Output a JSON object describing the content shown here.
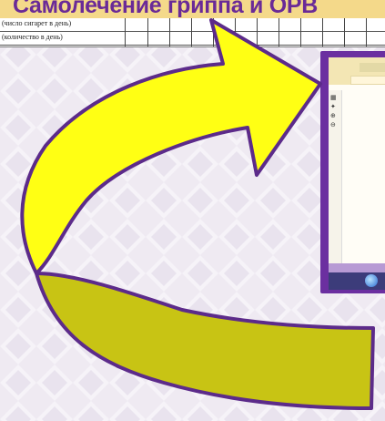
{
  "title": "Самолечение гриппа и ОРВ",
  "table": {
    "rows": [
      {
        "label": "(число сигарет в день)"
      },
      {
        "label": "(количество в день)"
      }
    ]
  },
  "icons": [
    "grid-icon",
    "arrow-icon",
    "zoom-in-icon",
    "zoom-out-icon"
  ],
  "colors": {
    "title": "#6a2a97",
    "title_bar": "#f4d98a",
    "arrow_fill": "#ffff14",
    "arrow_dark": "#c9c414",
    "arrow_outline": "#5c2b8a",
    "frame": "#6b2fa0"
  }
}
